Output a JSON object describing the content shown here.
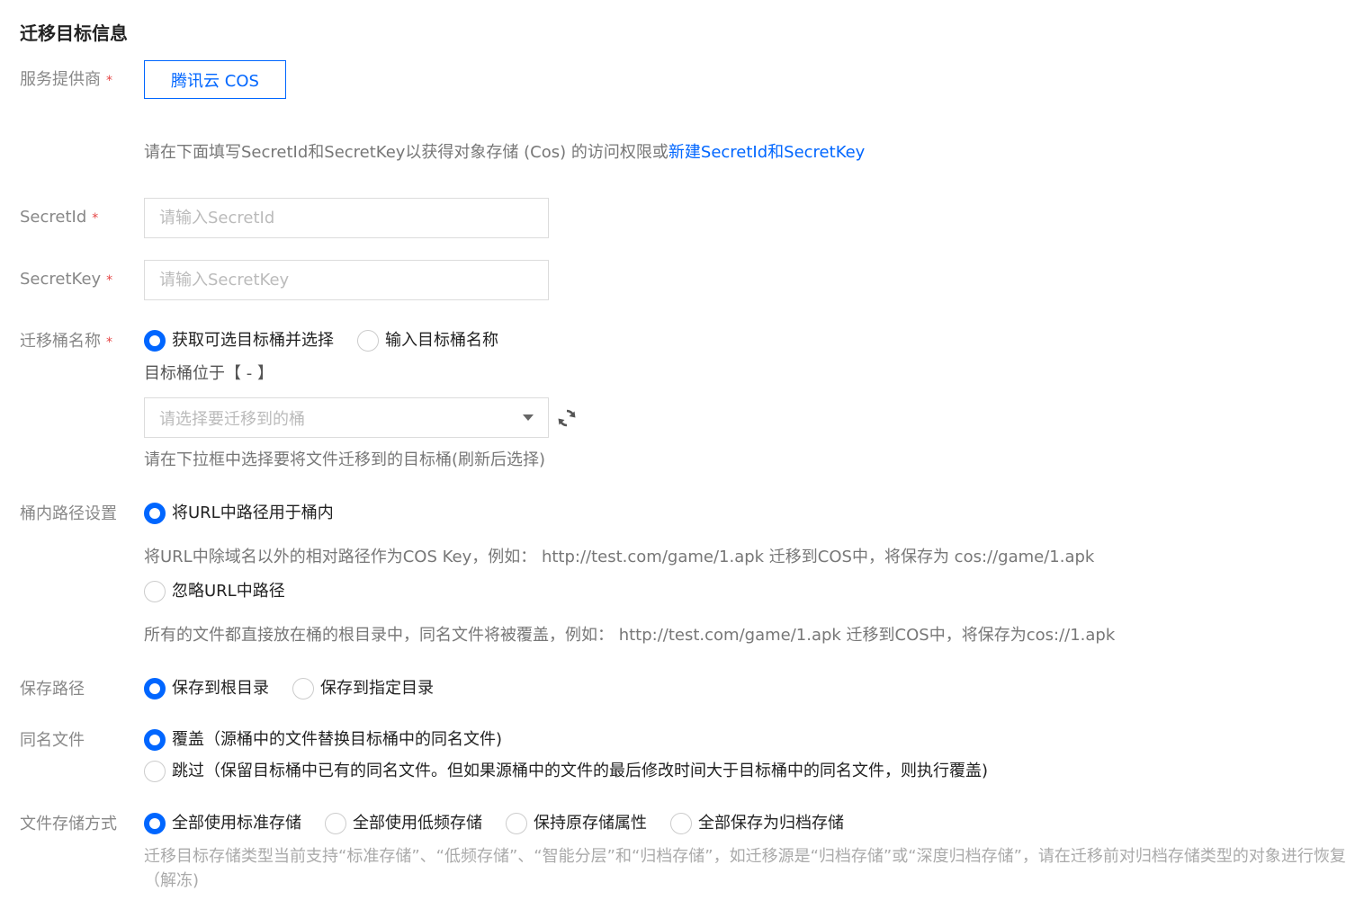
{
  "section_title": "迁移目标信息",
  "provider": {
    "label": "服务提供商",
    "required": "*",
    "value": "腾讯云 COS"
  },
  "credential_hint": {
    "text": "请在下面填写SecretId和SecretKey以获得对象存储 (Cos) 的访问权限或",
    "link": "新建SecretId和SecretKey"
  },
  "secret_id": {
    "label": "SecretId",
    "required": "*",
    "placeholder": "请输入SecretId",
    "value": ""
  },
  "secret_key": {
    "label": "SecretKey",
    "required": "*",
    "placeholder": "请输入SecretKey",
    "value": ""
  },
  "bucket_name": {
    "label": "迁移桶名称",
    "required": "*",
    "options": [
      "获取可选目标桶并选择",
      "输入目标桶名称"
    ],
    "selected": 0,
    "location_text": "目标桶位于【 - 】",
    "select_placeholder": "请选择要迁移到的桶",
    "hint": "请在下拉框中选择要将文件迁移到的目标桶(刷新后选择)"
  },
  "path_setting": {
    "label": "桶内路径设置",
    "option_use": "将URL中路径用于桶内",
    "use_desc": "将URL中除域名以外的相对路径作为COS Key，例如： http://test.com/game/1.apk 迁移到COS中，将保存为 cos://game/1.apk",
    "option_ignore": "忽略URL中路径",
    "ignore_desc": "所有的文件都直接放在桶的根目录中，同名文件将被覆盖，例如： http://test.com/game/1.apk 迁移到COS中，将保存为cos://1.apk",
    "selected": 0
  },
  "save_path": {
    "label": "保存路径",
    "options": [
      "保存到根目录",
      "保存到指定目录"
    ],
    "selected": 0
  },
  "same_name": {
    "label": "同名文件",
    "options": [
      "覆盖（源桶中的文件替换目标桶中的同名文件)",
      "跳过（保留目标桶中已有的同名文件。但如果源桶中的文件的最后修改时间大于目标桶中的同名文件，则执行覆盖)"
    ],
    "selected": 0
  },
  "storage": {
    "label": "文件存储方式",
    "options": [
      "全部使用标准存储",
      "全部使用低频存储",
      "保持原存储属性",
      "全部保存为归档存储"
    ],
    "selected": 0,
    "hint_line1": "迁移目标存储类型当前支持“标准存储”、“低频存储”、“智能分层”和“归档存储”，如迁移源是“归档存储”或“深度归档存储”，请在迁移前对归档存储类型的对象进行恢复",
    "hint_line2": "（解冻)"
  },
  "colors": {
    "accent": "#0066ff",
    "required": "#e54545",
    "label": "#888888",
    "hint": "#777777"
  },
  "icons": {
    "refresh": "refresh-icon",
    "dropdown": "chevron-down-icon"
  }
}
